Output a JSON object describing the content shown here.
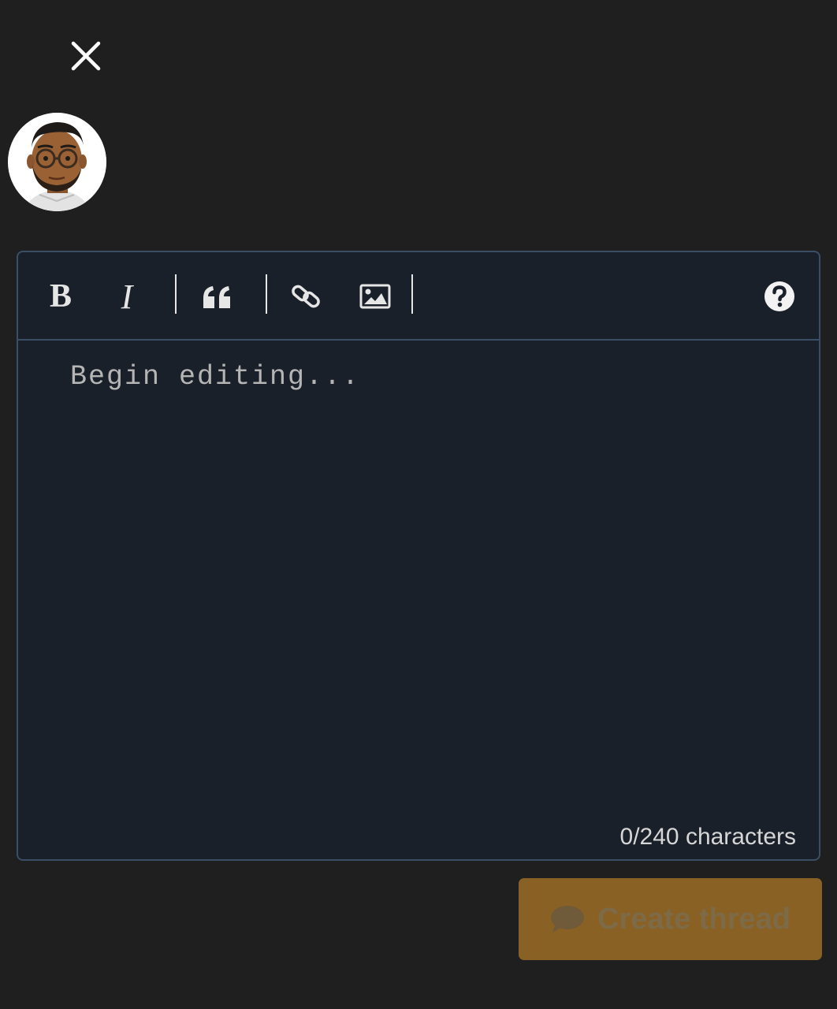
{
  "header": {
    "close_icon": "close-icon"
  },
  "user": {
    "avatar_icon": "user-avatar"
  },
  "toolbar": {
    "bold_label": "B",
    "italic_label": "I",
    "quote_icon": "quote-icon",
    "link_icon": "link-icon",
    "image_icon": "image-icon",
    "help_icon": "help-icon"
  },
  "editor": {
    "placeholder": "Begin editing...",
    "value": "",
    "counter": "0/240 characters"
  },
  "actions": {
    "create_label": "Create thread",
    "create_icon": "chat-bubble-icon"
  },
  "colors": {
    "background": "#1f1f1f",
    "editor_bg": "#1a202a",
    "editor_border": "#3a4f66",
    "button_bg": "#8a6124"
  }
}
